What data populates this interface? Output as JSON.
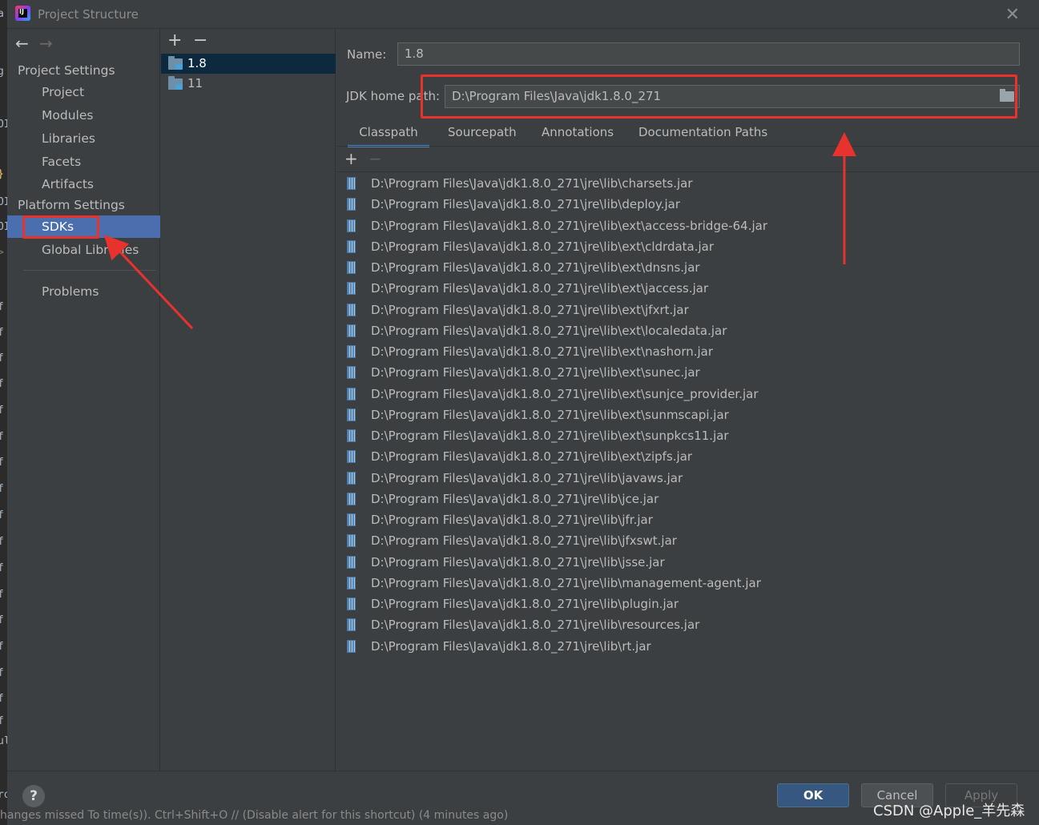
{
  "background_editor": {
    "fragments": [
      "a",
      "g",
      "OI",
      "}",
      "OI",
      "OI",
      ">",
      "f",
      "f",
      "f",
      "f",
      "f",
      "f",
      "f",
      "f",
      "f",
      "f",
      "f",
      "f",
      "f",
      "f",
      "f",
      "f",
      "f",
      "ul",
      "ro"
    ]
  },
  "window": {
    "title": "Project Structure",
    "logo_text": "IJ",
    "close_glyph": "✕"
  },
  "nav": {
    "back_glyph": "←",
    "forward_glyph": "→",
    "project_settings_header": "Project Settings",
    "project_items": [
      "Project",
      "Modules",
      "Libraries",
      "Facets",
      "Artifacts"
    ],
    "platform_settings_header": "Platform Settings",
    "platform_items": [
      "SDKs",
      "Global Libraries"
    ],
    "selected_item": "SDKs",
    "problems_item": "Problems"
  },
  "sdk_list": {
    "add_glyph": "+",
    "remove_glyph": "−",
    "items": [
      "1.8",
      "11"
    ],
    "selected": "1.8"
  },
  "details": {
    "name_label": "Name:",
    "name_value": "1.8",
    "jdk_home_label": "JDK home path:",
    "jdk_home_value": "D:\\Program Files\\Java\\jdk1.8.0_271",
    "tabs": [
      "Classpath",
      "Sourcepath",
      "Annotations",
      "Documentation Paths"
    ],
    "active_tab": "Classpath",
    "list_add_glyph": "+",
    "list_remove_glyph": "−",
    "classpath": [
      "D:\\Program Files\\Java\\jdk1.8.0_271\\jre\\lib\\charsets.jar",
      "D:\\Program Files\\Java\\jdk1.8.0_271\\jre\\lib\\deploy.jar",
      "D:\\Program Files\\Java\\jdk1.8.0_271\\jre\\lib\\ext\\access-bridge-64.jar",
      "D:\\Program Files\\Java\\jdk1.8.0_271\\jre\\lib\\ext\\cldrdata.jar",
      "D:\\Program Files\\Java\\jdk1.8.0_271\\jre\\lib\\ext\\dnsns.jar",
      "D:\\Program Files\\Java\\jdk1.8.0_271\\jre\\lib\\ext\\jaccess.jar",
      "D:\\Program Files\\Java\\jdk1.8.0_271\\jre\\lib\\ext\\jfxrt.jar",
      "D:\\Program Files\\Java\\jdk1.8.0_271\\jre\\lib\\ext\\localedata.jar",
      "D:\\Program Files\\Java\\jdk1.8.0_271\\jre\\lib\\ext\\nashorn.jar",
      "D:\\Program Files\\Java\\jdk1.8.0_271\\jre\\lib\\ext\\sunec.jar",
      "D:\\Program Files\\Java\\jdk1.8.0_271\\jre\\lib\\ext\\sunjce_provider.jar",
      "D:\\Program Files\\Java\\jdk1.8.0_271\\jre\\lib\\ext\\sunmscapi.jar",
      "D:\\Program Files\\Java\\jdk1.8.0_271\\jre\\lib\\ext\\sunpkcs11.jar",
      "D:\\Program Files\\Java\\jdk1.8.0_271\\jre\\lib\\ext\\zipfs.jar",
      "D:\\Program Files\\Java\\jdk1.8.0_271\\jre\\lib\\javaws.jar",
      "D:\\Program Files\\Java\\jdk1.8.0_271\\jre\\lib\\jce.jar",
      "D:\\Program Files\\Java\\jdk1.8.0_271\\jre\\lib\\jfr.jar",
      "D:\\Program Files\\Java\\jdk1.8.0_271\\jre\\lib\\jfxswt.jar",
      "D:\\Program Files\\Java\\jdk1.8.0_271\\jre\\lib\\jsse.jar",
      "D:\\Program Files\\Java\\jdk1.8.0_271\\jre\\lib\\management-agent.jar",
      "D:\\Program Files\\Java\\jdk1.8.0_271\\jre\\lib\\plugin.jar",
      "D:\\Program Files\\Java\\jdk1.8.0_271\\jre\\lib\\resources.jar",
      "D:\\Program Files\\Java\\jdk1.8.0_271\\jre\\lib\\rt.jar"
    ]
  },
  "buttons": {
    "help": "?",
    "ok": "OK",
    "cancel": "Cancel",
    "apply": "Apply"
  },
  "status_bar_text": "hanges missed To time(s)). Ctrl+Shift+O  // (Disable alert for this shortcut) (4 minutes ago)",
  "watermark": "CSDN @Apple_羊先森",
  "colors": {
    "annotation_red": "#e8322d",
    "selection_blue": "#4b6eaf",
    "dialog_bg": "#3c3f41"
  }
}
